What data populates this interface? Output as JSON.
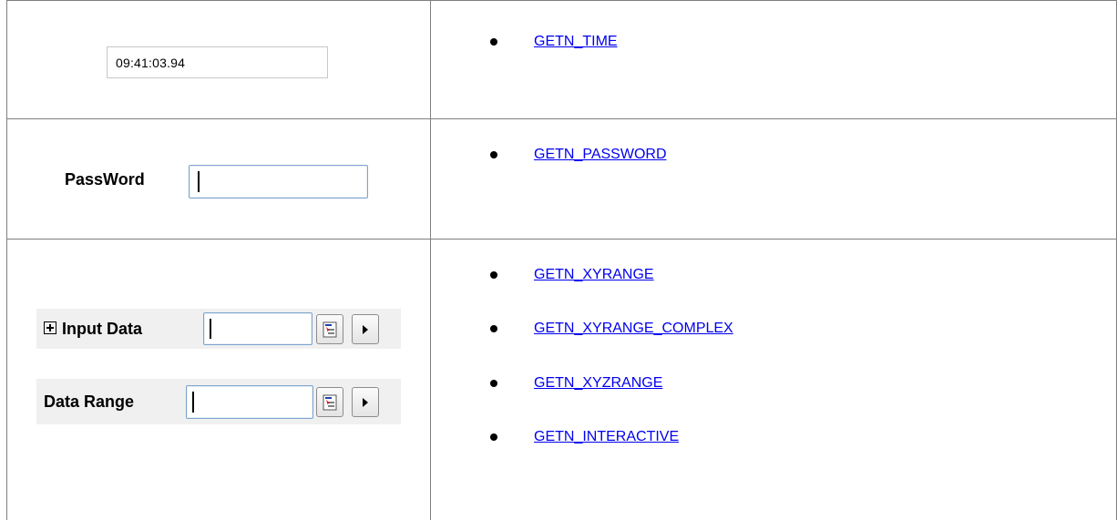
{
  "rows": {
    "time": {
      "value": "09:41:03.94",
      "links": [
        "GETN_TIME"
      ]
    },
    "password": {
      "label": "PassWord",
      "value": "",
      "links": [
        "GETN_PASSWORD"
      ]
    },
    "range": {
      "input_label": "Input Data",
      "range_label": "Data Range",
      "input_value": "",
      "range_value": "",
      "links": [
        "GETN_XYRANGE",
        "GETN_XYRANGE_COMPLEX",
        "GETN_XYZRANGE",
        "GETN_INTERACTIVE"
      ]
    }
  },
  "icons": {
    "select_range": "select-range-icon",
    "arrow": "play-arrow-icon",
    "expand": "expand-plus-icon"
  },
  "colors": {
    "link": "#0000ee",
    "grid": "#7f7f7f",
    "input_border": "#7fa4cf"
  }
}
